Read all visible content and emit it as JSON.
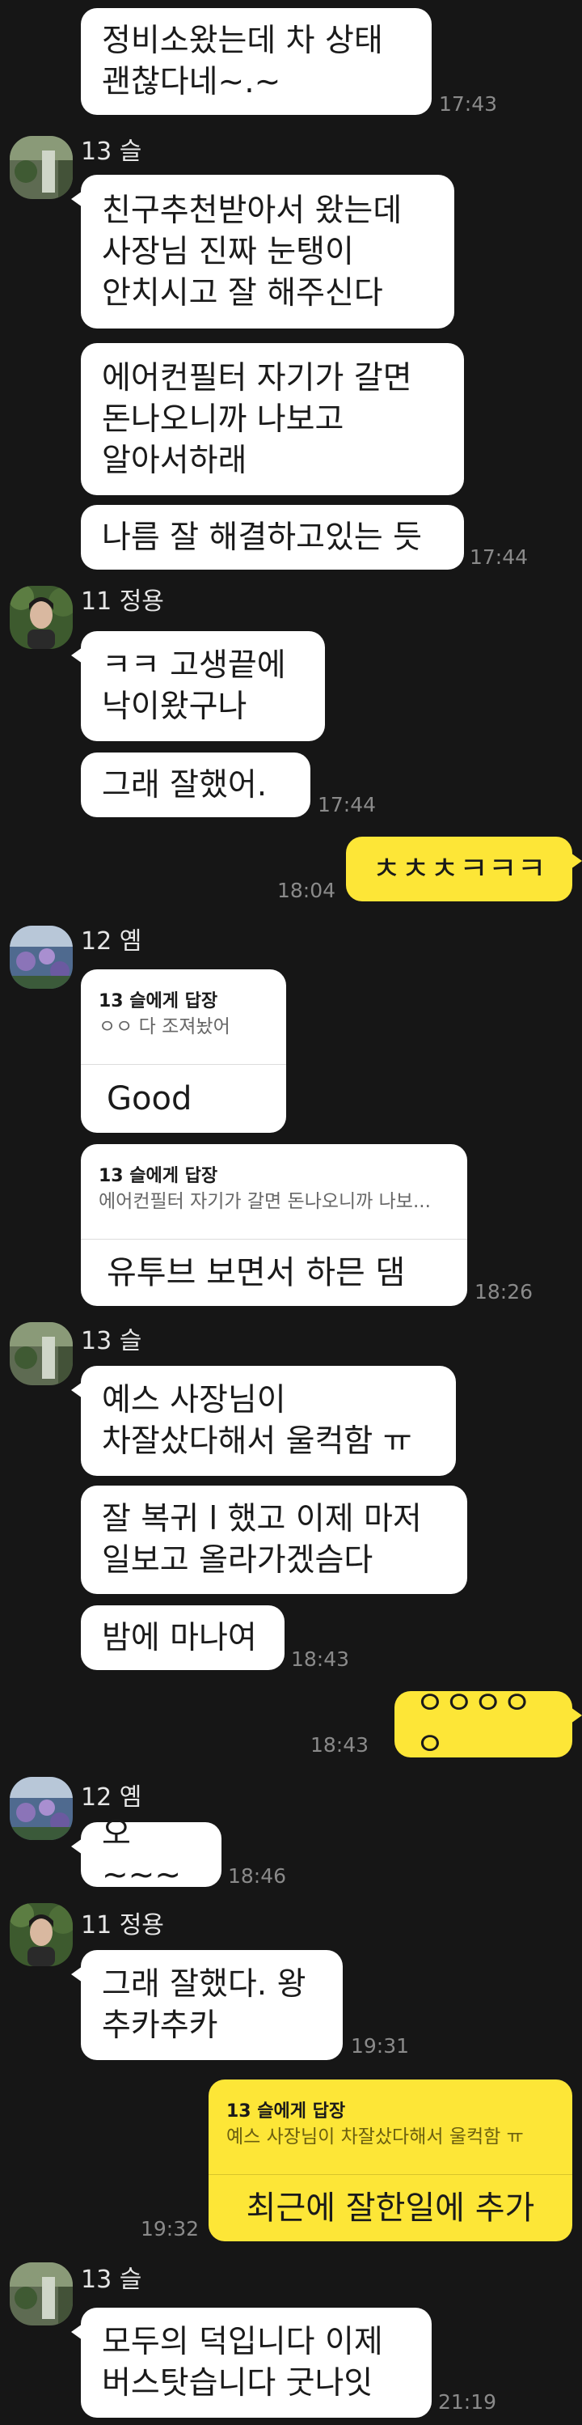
{
  "messages": {
    "m1": {
      "text": "정비소왔는데 차 상태\n괜찮다네~.~",
      "time": "17:43"
    },
    "u13_a": {
      "name": "13 슬"
    },
    "m2": {
      "text": "친구추천받아서 왔는데\n사장님 진짜 눈탱이\n안치시고 잘 해주신다"
    },
    "m3": {
      "text": "에어컨필터 자기가 갈면\n돈나오니까 나보고\n알아서하래"
    },
    "m4": {
      "text": "나름 잘 해결하고있는 듯",
      "time": "17:44"
    },
    "u11_a": {
      "name": "11 정용"
    },
    "m5": {
      "text": "ㅋㅋ 고생끝에\n낙이왔구나"
    },
    "m6": {
      "text": "그래 잘했어.",
      "time": "17:44"
    },
    "m7": {
      "text": "ㅊㅊㅊㅋㅋㅋ",
      "time": "18:04"
    },
    "u12_a": {
      "name": "12 옘"
    },
    "r1": {
      "title": "13 슬에게 답장",
      "quote": "ㅇㅇ 다 조져놨어",
      "text": "Good"
    },
    "r2": {
      "title": "13 슬에게 답장",
      "quote": "에어컨필터 자기가 갈면 돈나오니까 나보...",
      "text": "유투브 보면서 하믄 댐",
      "time": "18:26"
    },
    "u13_b": {
      "name": "13 슬"
    },
    "m8": {
      "text": "예스 사장님이\n차잘샀다해서 울컥함 ㅠ"
    },
    "m9": {
      "text": "잘 복귀 l 했고 이제 마저\n일보고 올라가겠슴다"
    },
    "m10": {
      "text": "밤에 마나여",
      "time": "18:43"
    },
    "m11": {
      "text": "ㅇㅇㅇㅇㅇ",
      "time": "18:43"
    },
    "u12_b": {
      "name": "12 옘"
    },
    "m12": {
      "text": "오~~~",
      "time": "18:46"
    },
    "u11_b": {
      "name": "11 정용"
    },
    "m13": {
      "text": "그래 잘했다. 왕\n추카추카",
      "time": "19:31"
    },
    "r3": {
      "title": "13 슬에게 답장",
      "quote": "예스 사장님이 차잘샀다해서 울컥함 ㅠ",
      "text": "최근에 잘한일에 추가",
      "time": "19:32"
    },
    "u13_c": {
      "name": "13 슬"
    },
    "m14": {
      "text": "모두의 덕입니다 이제\n버스탓습니다  굿나잇",
      "time": "21:19"
    }
  },
  "colors": {
    "background": "#161616",
    "my_bubble": "#fde637",
    "other_bubble": "#ffffff",
    "time_text": "#8a8a8a"
  },
  "icons": {
    "avatar_13": "garden-photo",
    "avatar_11": "person-portrait",
    "avatar_12": "flower-photo"
  }
}
